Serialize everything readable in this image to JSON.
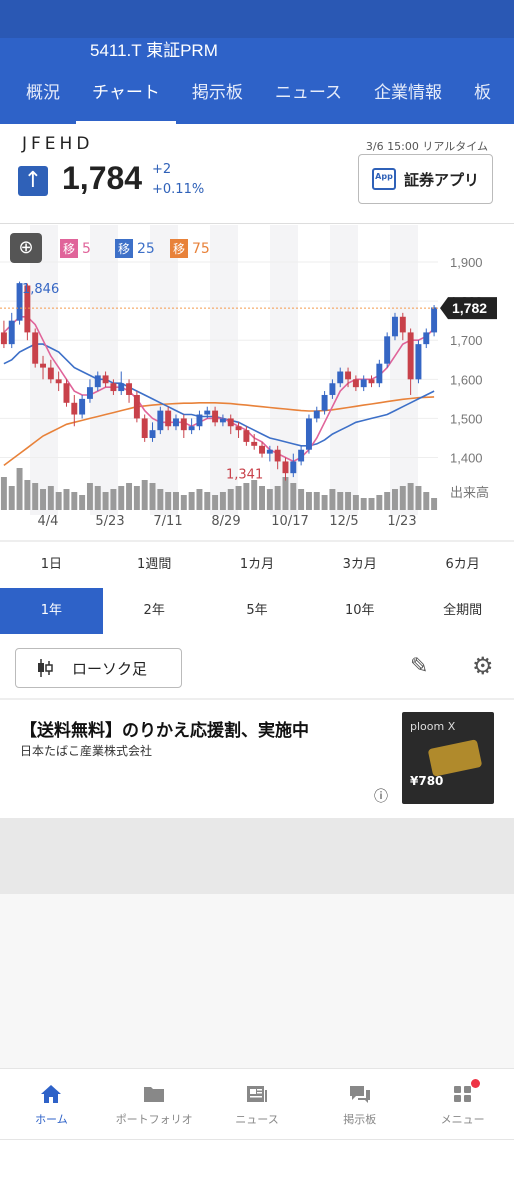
{
  "header": {
    "ticker_title": "5411.T 東証PRM",
    "tabs": [
      {
        "label": "概況"
      },
      {
        "label": "チャート"
      },
      {
        "label": "掲示板"
      },
      {
        "label": "ニュース"
      },
      {
        "label": "企業情報"
      },
      {
        "label": "板"
      }
    ],
    "active_tab": "チャート"
  },
  "quote": {
    "name": "JFEHD",
    "price": "1,784",
    "change": "+2",
    "change_pct": "+0.11%",
    "timestamp": "3/6 15:00 リアルタイム",
    "app_button": "証券アプリ",
    "app_icon_text": "App"
  },
  "chart_legend": {
    "badge": "移",
    "ma_short": "5",
    "ma_mid": "25",
    "ma_long": "75",
    "colors": {
      "ma_short": "#e0649a",
      "ma_mid": "#3d70c8",
      "ma_long": "#e8823a"
    }
  },
  "chart_data": {
    "type": "candlestick",
    "y_ticks": [
      "1,900",
      "1,800",
      "1,700",
      "1,600",
      "1,500",
      "1,400"
    ],
    "ylim": [
      1340,
      1920
    ],
    "x_ticks": [
      "4/4",
      "5/23",
      "7/11",
      "8/29",
      "10/17",
      "12/5",
      "1/23"
    ],
    "high_label": "1,846",
    "low_label": "1,341",
    "current_label": "1,782",
    "volume_label": "出来高",
    "candles": [
      [
        1720,
        1690,
        1750,
        1680
      ],
      [
        1690,
        1750,
        1770,
        1680
      ],
      [
        1750,
        1846,
        1850,
        1740
      ],
      [
        1840,
        1720,
        1845,
        1700
      ],
      [
        1720,
        1640,
        1730,
        1630
      ],
      [
        1640,
        1630,
        1660,
        1600
      ],
      [
        1630,
        1600,
        1650,
        1590
      ],
      [
        1600,
        1590,
        1620,
        1570
      ],
      [
        1590,
        1540,
        1600,
        1530
      ],
      [
        1540,
        1510,
        1560,
        1480
      ],
      [
        1510,
        1550,
        1560,
        1500
      ],
      [
        1550,
        1580,
        1600,
        1540
      ],
      [
        1580,
        1610,
        1620,
        1570
      ],
      [
        1610,
        1590,
        1620,
        1580
      ],
      [
        1590,
        1570,
        1600,
        1560
      ],
      [
        1570,
        1590,
        1620,
        1560
      ],
      [
        1590,
        1560,
        1600,
        1540
      ],
      [
        1560,
        1500,
        1570,
        1490
      ],
      [
        1500,
        1450,
        1510,
        1440
      ],
      [
        1450,
        1470,
        1490,
        1440
      ],
      [
        1470,
        1520,
        1530,
        1460
      ],
      [
        1520,
        1480,
        1530,
        1470
      ],
      [
        1480,
        1500,
        1510,
        1470
      ],
      [
        1500,
        1470,
        1510,
        1450
      ],
      [
        1470,
        1480,
        1500,
        1460
      ],
      [
        1480,
        1510,
        1520,
        1470
      ],
      [
        1510,
        1520,
        1530,
        1500
      ],
      [
        1520,
        1490,
        1530,
        1480
      ],
      [
        1490,
        1500,
        1510,
        1480
      ],
      [
        1500,
        1480,
        1510,
        1460
      ],
      [
        1480,
        1470,
        1490,
        1450
      ],
      [
        1470,
        1440,
        1480,
        1430
      ],
      [
        1440,
        1430,
        1460,
        1420
      ],
      [
        1430,
        1410,
        1440,
        1400
      ],
      [
        1410,
        1420,
        1430,
        1390
      ],
      [
        1420,
        1390,
        1430,
        1370
      ],
      [
        1390,
        1360,
        1400,
        1341
      ],
      [
        1360,
        1390,
        1410,
        1350
      ],
      [
        1390,
        1420,
        1430,
        1380
      ],
      [
        1420,
        1500,
        1510,
        1410
      ],
      [
        1500,
        1520,
        1530,
        1490
      ],
      [
        1520,
        1560,
        1570,
        1510
      ],
      [
        1560,
        1590,
        1600,
        1550
      ],
      [
        1590,
        1620,
        1630,
        1580
      ],
      [
        1620,
        1600,
        1630,
        1580
      ],
      [
        1600,
        1580,
        1610,
        1570
      ],
      [
        1580,
        1600,
        1610,
        1570
      ],
      [
        1600,
        1590,
        1610,
        1580
      ],
      [
        1590,
        1640,
        1650,
        1580
      ],
      [
        1640,
        1710,
        1720,
        1630
      ],
      [
        1710,
        1760,
        1770,
        1700
      ],
      [
        1760,
        1720,
        1770,
        1700
      ],
      [
        1720,
        1600,
        1730,
        1560
      ],
      [
        1600,
        1690,
        1700,
        1590
      ],
      [
        1690,
        1720,
        1730,
        1680
      ],
      [
        1720,
        1784,
        1790,
        1710
      ]
    ],
    "ma_short": [
      1720,
      1740,
      1760,
      1760,
      1740,
      1700,
      1660,
      1630,
      1600,
      1570,
      1560,
      1560,
      1570,
      1580,
      1580,
      1580,
      1570,
      1550,
      1520,
      1500,
      1490,
      1490,
      1490,
      1490,
      1480,
      1490,
      1500,
      1500,
      1500,
      1490,
      1480,
      1470,
      1450,
      1440,
      1420,
      1410,
      1400,
      1390,
      1400,
      1420,
      1450,
      1490,
      1530,
      1570,
      1590,
      1600,
      1600,
      1600,
      1610,
      1630,
      1660,
      1690,
      1700,
      1700,
      1710,
      1730
    ],
    "ma_mid": [
      1640,
      1650,
      1670,
      1680,
      1690,
      1690,
      1680,
      1670,
      1650,
      1630,
      1620,
      1610,
      1600,
      1600,
      1590,
      1590,
      1580,
      1570,
      1560,
      1550,
      1540,
      1530,
      1520,
      1510,
      1510,
      1505,
      1505,
      1505,
      1500,
      1495,
      1490,
      1480,
      1470,
      1460,
      1450,
      1445,
      1440,
      1435,
      1430,
      1430,
      1435,
      1445,
      1460,
      1470,
      1480,
      1490,
      1495,
      1500,
      1505,
      1510,
      1520,
      1530,
      1540,
      1550,
      1560,
      1570
    ],
    "ma_long": [
      1380,
      1395,
      1410,
      1425,
      1440,
      1455,
      1465,
      1475,
      1485,
      1490,
      1495,
      1500,
      1505,
      1510,
      1515,
      1520,
      1525,
      1530,
      1532,
      1534,
      1536,
      1537,
      1538,
      1539,
      1539,
      1540,
      1540,
      1540,
      1539,
      1538,
      1536,
      1534,
      1532,
      1530,
      1528,
      1526,
      1524,
      1522,
      1520,
      1519,
      1519,
      1520,
      1522,
      1525,
      1528,
      1531,
      1534,
      1537,
      1540,
      1543,
      1546,
      1549,
      1551,
      1553,
      1554,
      1555
    ],
    "volumes": [
      0.55,
      0.4,
      0.7,
      0.5,
      0.45,
      0.35,
      0.4,
      0.3,
      0.35,
      0.3,
      0.25,
      0.45,
      0.4,
      0.3,
      0.35,
      0.4,
      0.45,
      0.4,
      0.5,
      0.45,
      0.35,
      0.3,
      0.3,
      0.25,
      0.3,
      0.35,
      0.3,
      0.25,
      0.3,
      0.35,
      0.4,
      0.45,
      0.5,
      0.4,
      0.35,
      0.4,
      0.55,
      0.45,
      0.35,
      0.3,
      0.3,
      0.25,
      0.35,
      0.3,
      0.3,
      0.25,
      0.2,
      0.2,
      0.25,
      0.3,
      0.35,
      0.4,
      0.45,
      0.4,
      0.3,
      0.2
    ]
  },
  "periods": {
    "row1": [
      "1日",
      "1週間",
      "1カ月",
      "3カ月",
      "6カ月"
    ],
    "row2": [
      "1年",
      "2年",
      "5年",
      "10年",
      "全期間"
    ],
    "active": "1年"
  },
  "controls": {
    "chart_type_label": "ローソク足"
  },
  "ad": {
    "title": "【送料無料】のりかえ応援割、実施中",
    "advertiser": "日本たばこ産業株式会社",
    "image_brand": "ploom X",
    "image_price": "¥780"
  },
  "bottom_nav": [
    {
      "label": "ホーム",
      "icon": "home-icon"
    },
    {
      "label": "ポートフォリオ",
      "icon": "folder-icon"
    },
    {
      "label": "ニュース",
      "icon": "news-icon"
    },
    {
      "label": "掲示板",
      "icon": "chat-icon"
    },
    {
      "label": "メニュー",
      "icon": "menu-grid-icon"
    }
  ]
}
